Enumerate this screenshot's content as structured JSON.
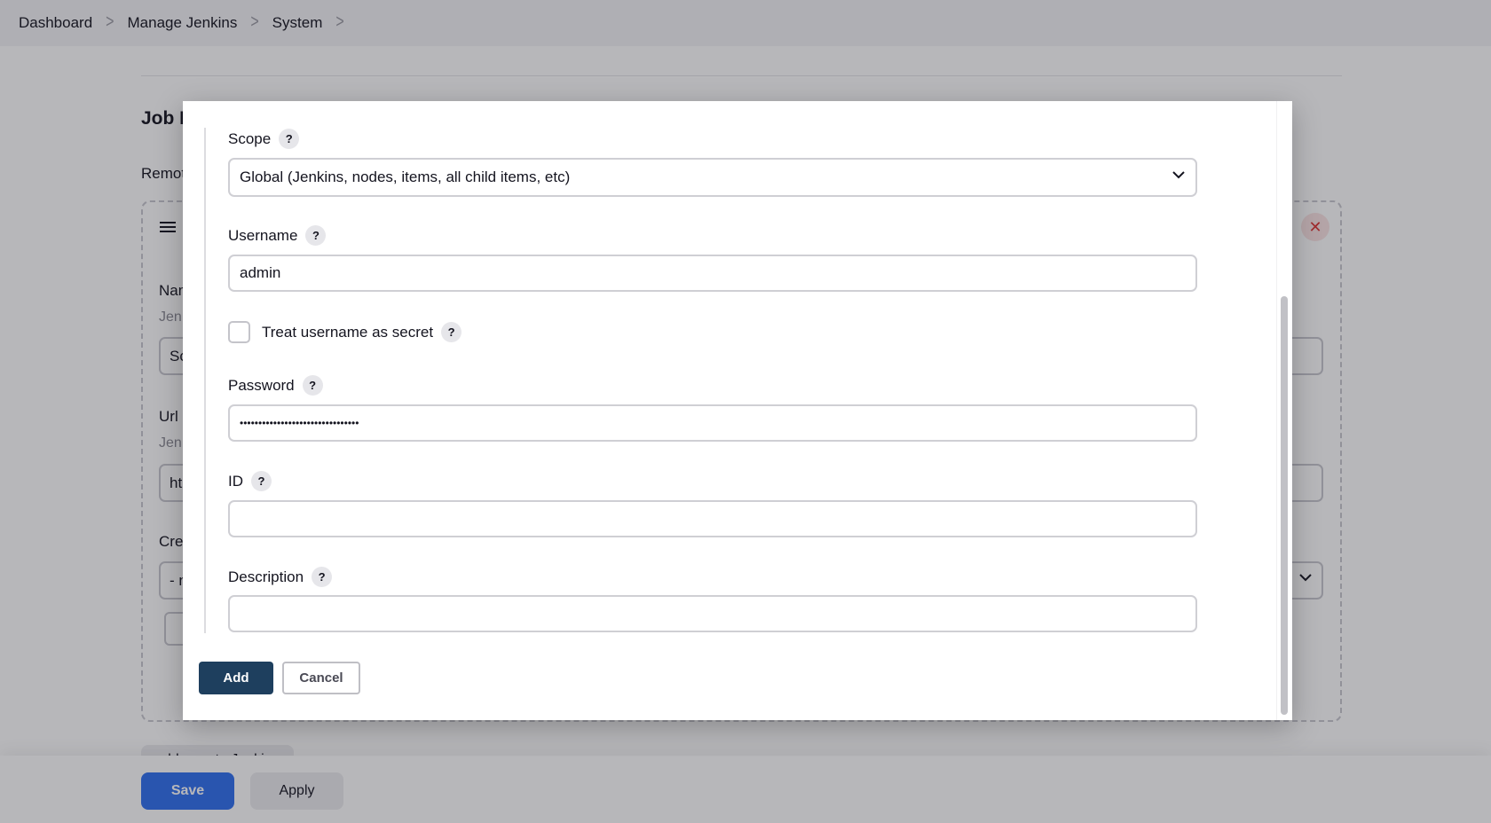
{
  "breadcrumb": {
    "items": [
      "Dashboard",
      "Manage Jenkins",
      "System"
    ],
    "separator": ">"
  },
  "background": {
    "section_title": "Job I",
    "remote_label": "Remot",
    "fields": [
      {
        "label": "Nam",
        "hint": "Jen",
        "value": "Sc"
      },
      {
        "label": "Url",
        "hint": "Jen",
        "value": "ht"
      },
      {
        "label": "Cre",
        "value": "- n"
      }
    ],
    "delete_symbol": "✕",
    "add_remote_label": "add remote Jenkins",
    "save_label": "Save",
    "apply_label": "Apply"
  },
  "modal": {
    "scope": {
      "label": "Scope",
      "value": "Global (Jenkins, nodes, items, all child items, etc)"
    },
    "username": {
      "label": "Username",
      "value": "admin"
    },
    "treat_secret": {
      "label": "Treat username as secret",
      "checked": false
    },
    "password": {
      "label": "Password",
      "value": "••••••••••••••••••••••••••••••••"
    },
    "id": {
      "label": "ID",
      "value": ""
    },
    "description": {
      "label": "Description",
      "value": ""
    },
    "help_symbol": "?",
    "add_label": "Add",
    "cancel_label": "Cancel"
  },
  "colors": {
    "primary_button": "#2f6fef",
    "modal_add_button": "#1e3f5e",
    "delete_accent": "#dd3333"
  }
}
